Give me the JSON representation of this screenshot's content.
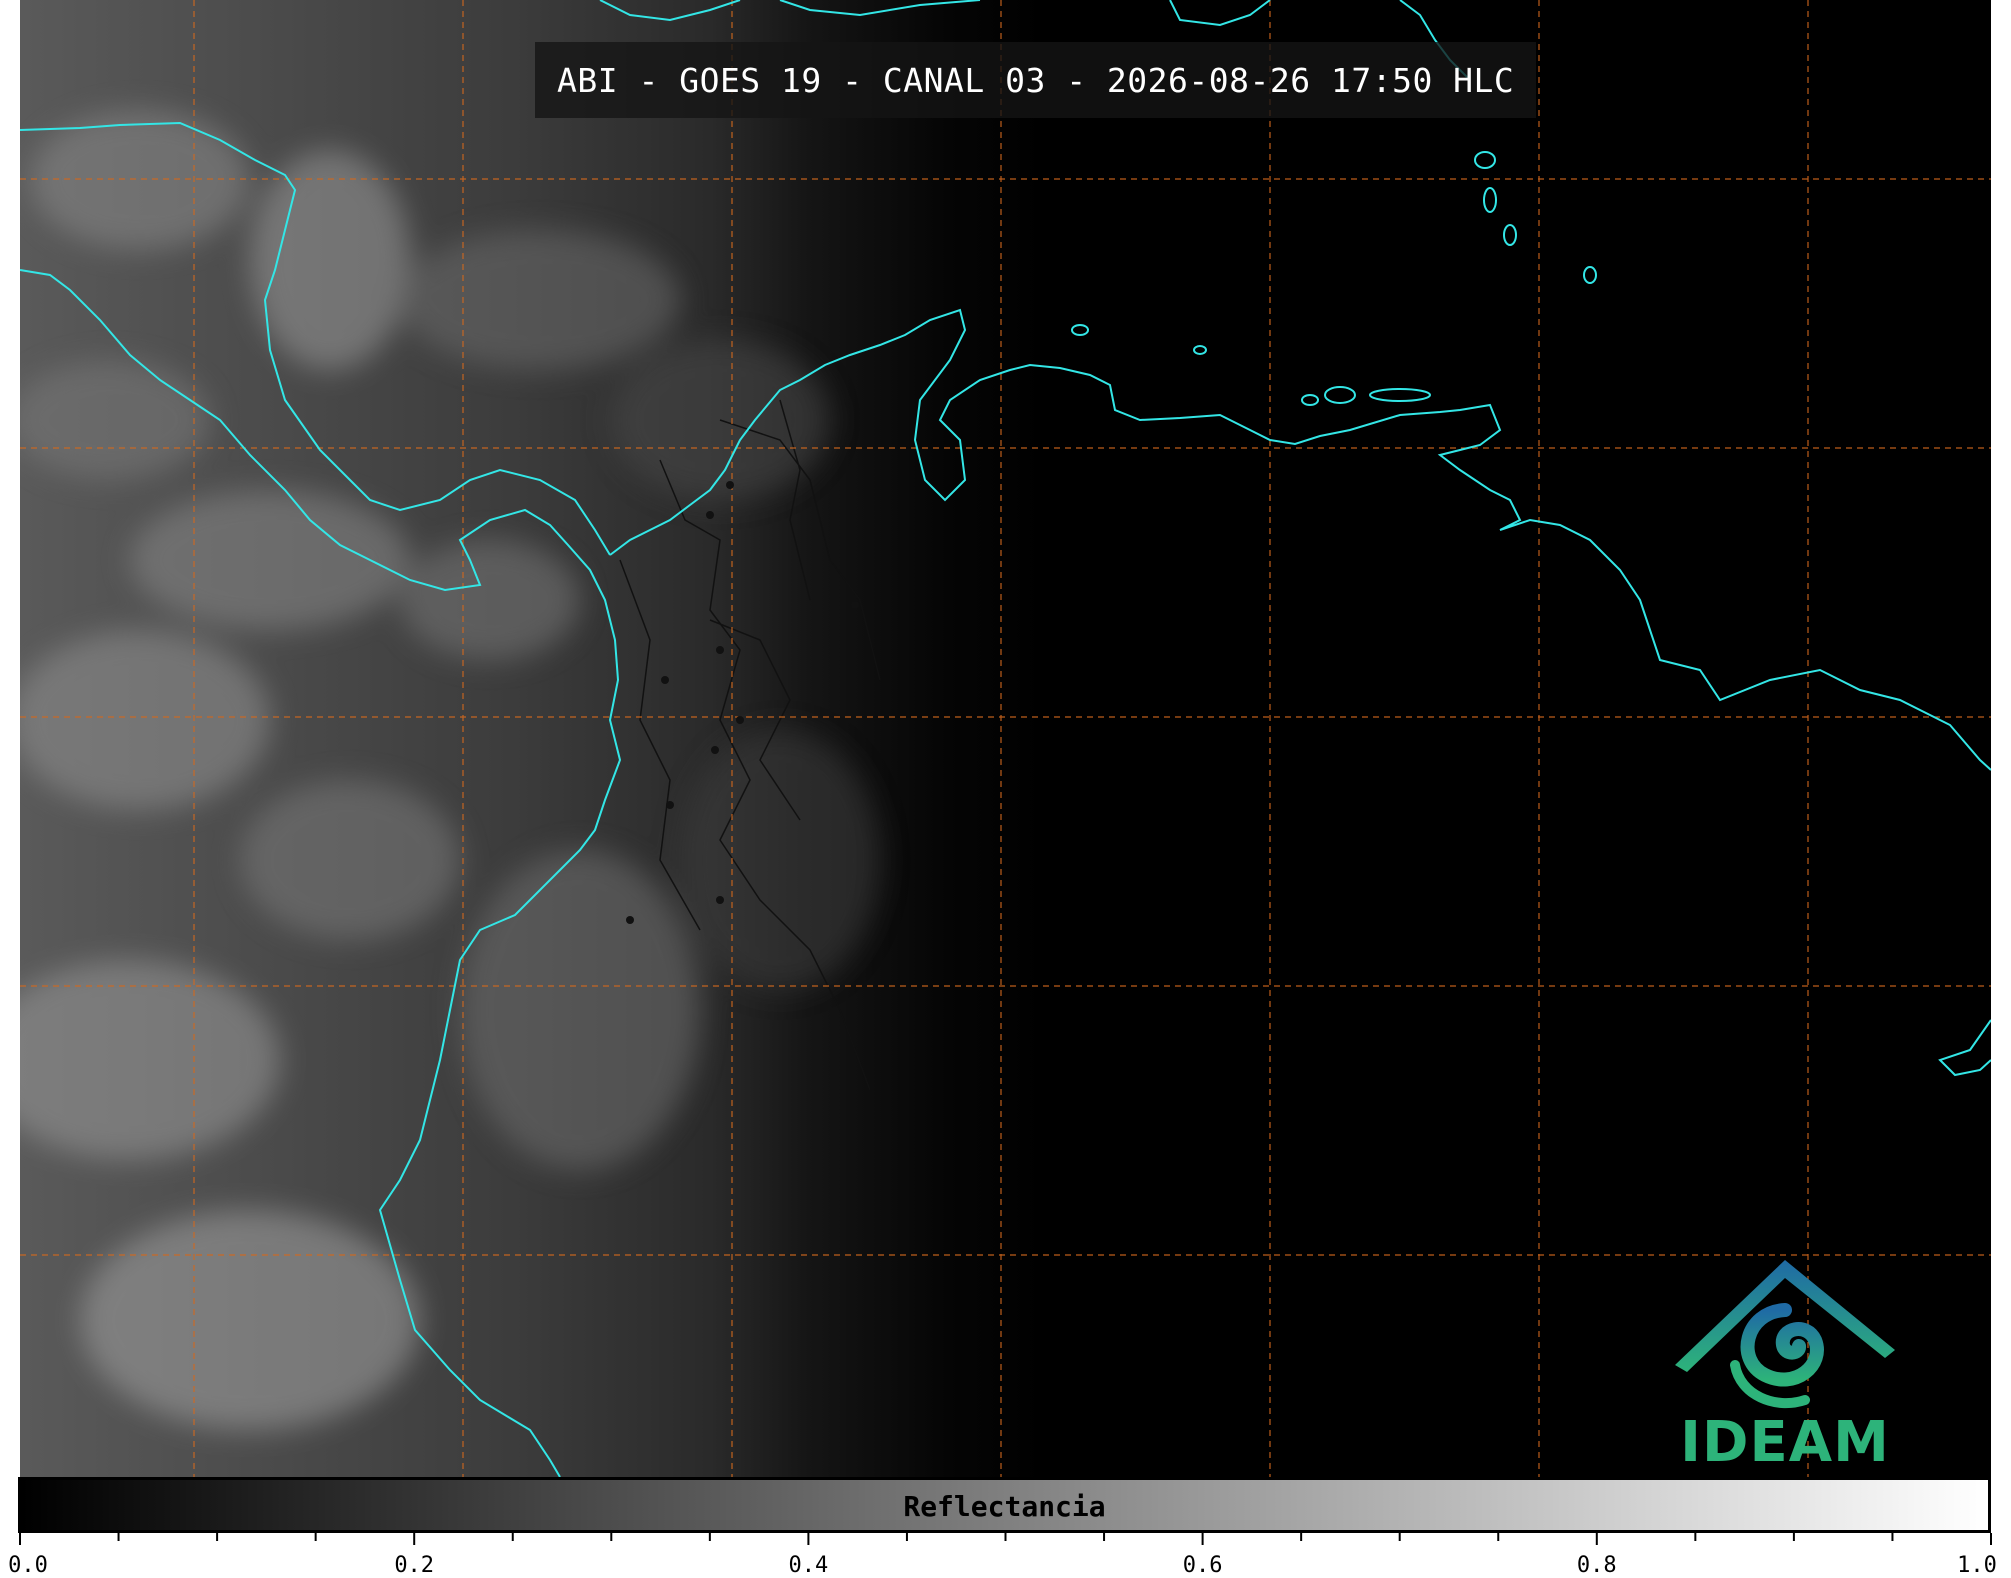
{
  "title": "ABI - GOES 19 - CANAL 03 - 2026-08-26 17:50 HLC",
  "colorbar": {
    "label": "Reflectancia",
    "ticks": [
      "0.0",
      "0.2",
      "0.4",
      "0.6",
      "0.8",
      "1.0"
    ],
    "range": [
      0.0,
      1.0
    ],
    "colormap": [
      "#000000",
      "#ffffff"
    ]
  },
  "logo": {
    "text": "IDEAM"
  },
  "colors": {
    "coastline": "#33e6e6",
    "gridline": "#d2691e",
    "borders": "#111111",
    "logo_blue": "#1f6aa5",
    "logo_green": "#2db37a"
  }
}
